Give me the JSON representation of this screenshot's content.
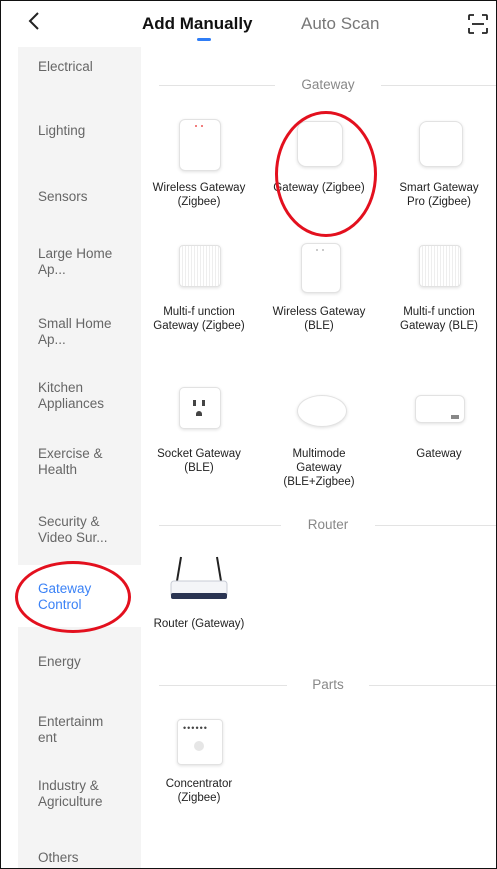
{
  "header": {
    "tabs": [
      {
        "label": "Add Manually",
        "active": true
      },
      {
        "label": "Auto Scan",
        "active": false
      }
    ],
    "accent_color": "#2f7df6",
    "icons": {
      "back": "chevron-left-icon",
      "scan": "scan-frame-icon"
    }
  },
  "sidebar": {
    "items": [
      {
        "label": "Electrical"
      },
      {
        "label": "Lighting"
      },
      {
        "label": "Sensors"
      },
      {
        "label": "Large Home Ap..."
      },
      {
        "label": "Small Home Ap..."
      },
      {
        "label": "Kitchen Appliances"
      },
      {
        "label": "Exercise & Health"
      },
      {
        "label": "Security & Video Sur..."
      },
      {
        "label": "Gateway Control",
        "active": true
      },
      {
        "label": "Energy"
      },
      {
        "label": "Entertainm ent"
      },
      {
        "label": "Industry & Agriculture"
      },
      {
        "label": "Others"
      }
    ]
  },
  "sections": [
    {
      "title": "Gateway",
      "devices": [
        {
          "label": "Wireless Gateway (Zigbee)"
        },
        {
          "label": "Gateway (Zigbee)"
        },
        {
          "label": "Smart Gateway Pro (Zigbee)"
        },
        {
          "label": "Multi-f unction Gateway (Zigbee)"
        },
        {
          "label": "Wireless Gateway (BLE)"
        },
        {
          "label": "Multi-f unction Gateway (BLE)"
        },
        {
          "label": "Socket Gateway (BLE)"
        },
        {
          "label": "Multimode Gateway (BLE+Zigbee)"
        },
        {
          "label": "Gateway"
        }
      ]
    },
    {
      "title": "Router",
      "devices": [
        {
          "label": "Router (Gateway)"
        }
      ]
    },
    {
      "title": "Parts",
      "devices": [
        {
          "label": "Concentrator (Zigbee)"
        }
      ]
    }
  ],
  "annotation_color": "#e3101e"
}
